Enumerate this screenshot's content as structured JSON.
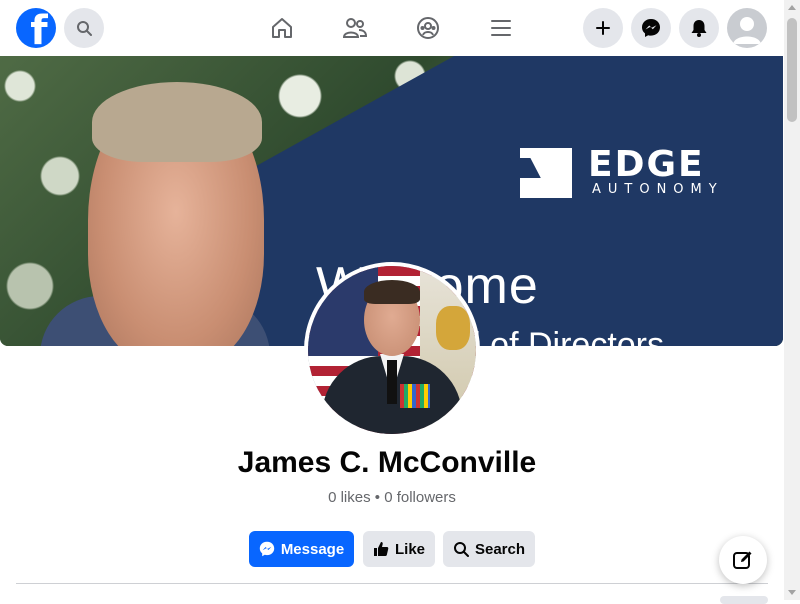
{
  "topbar": {
    "logo_letter": "f",
    "icons": {
      "search": "search-icon",
      "home": "home-icon",
      "friends": "friends-icon",
      "groups": "groups-icon",
      "menu": "menu-icon",
      "create": "plus-icon",
      "messenger": "messenger-icon",
      "notifications": "bell-icon",
      "account": "avatar"
    }
  },
  "cover": {
    "brand_word": "EDGE",
    "brand_sub": "AUTONOMY",
    "welcome_text": "Welcome",
    "board_text": "Board of Directors"
  },
  "profile": {
    "name": "James C. McConville",
    "stats": "0 likes • 0 followers"
  },
  "actions": {
    "message_label": "Message",
    "like_label": "Like",
    "search_label": "Search"
  },
  "colors": {
    "brand": "#0866ff",
    "secondary_btn": "#e4e6eb",
    "cover_navy": "#1f3864"
  }
}
